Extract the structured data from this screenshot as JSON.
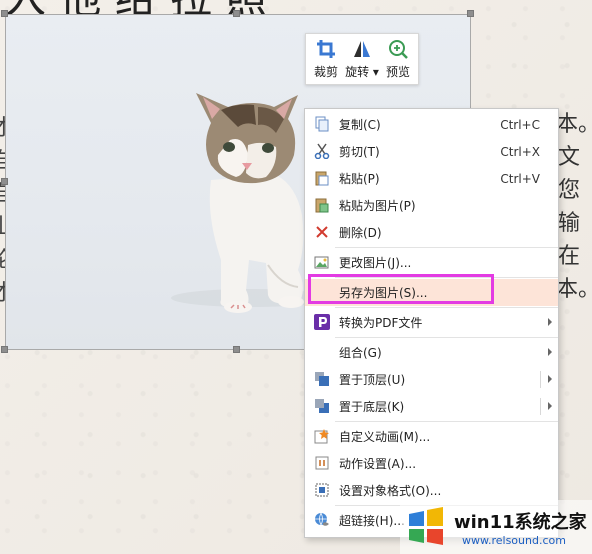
{
  "document": {
    "title_fragment": "入 他 给 拉 照",
    "left_chars": [
      "才",
      "自",
      "自",
      "山",
      "论",
      "才"
    ],
    "right_chars": [
      "本。",
      "的文",
      "入您",
      "比输",
      "请在",
      "本。"
    ]
  },
  "image_toolbar": {
    "buttons": [
      {
        "label": "裁剪",
        "icon": "crop-icon"
      },
      {
        "label": "旋转",
        "icon": "rotate-icon"
      },
      {
        "label": "预览",
        "icon": "preview-zoom-icon"
      }
    ]
  },
  "context_menu": {
    "items": [
      {
        "label": "复制(C)",
        "shortcut": "Ctrl+C",
        "icon": "copy-icon"
      },
      {
        "label": "剪切(T)",
        "shortcut": "Ctrl+X",
        "icon": "cut-icon"
      },
      {
        "label": "粘贴(P)",
        "shortcut": "Ctrl+V",
        "icon": "paste-icon"
      },
      {
        "label": "粘贴为图片(P)",
        "shortcut": "",
        "icon": "paste-as-image-icon"
      },
      {
        "label": "删除(D)",
        "shortcut": "",
        "icon": "delete-icon"
      },
      {
        "label": "更改图片(J)...",
        "shortcut": "",
        "icon": "change-picture-icon"
      },
      {
        "label": "另存为图片(S)...",
        "shortcut": "",
        "icon": "",
        "highlighted": true
      },
      {
        "label": "转换为PDF文件",
        "shortcut": "",
        "icon": "pdf-icon",
        "submenu": true
      },
      {
        "label": "组合(G)",
        "shortcut": "",
        "icon": "",
        "submenu": true
      },
      {
        "label": "置于顶层(U)",
        "shortcut": "",
        "icon": "bring-to-front-icon",
        "submenu": true
      },
      {
        "label": "置于底层(K)",
        "shortcut": "",
        "icon": "send-to-back-icon",
        "submenu": true
      },
      {
        "label": "自定义动画(M)...",
        "shortcut": "",
        "icon": "custom-animation-icon"
      },
      {
        "label": "动作设置(A)...",
        "shortcut": "",
        "icon": "action-settings-icon"
      },
      {
        "label": "设置对象格式(O)...",
        "shortcut": "",
        "icon": "format-object-icon"
      },
      {
        "label": "超链接(H)...",
        "shortcut": "",
        "icon": "hyperlink-icon"
      }
    ]
  },
  "watermark": {
    "brand": "win11系统之家",
    "url": "www.relsound.com"
  },
  "colors": {
    "highlight_bg": "#fde4d8",
    "annotation_box": "#e33be3",
    "pdf_purple": "#6a2ea8"
  }
}
